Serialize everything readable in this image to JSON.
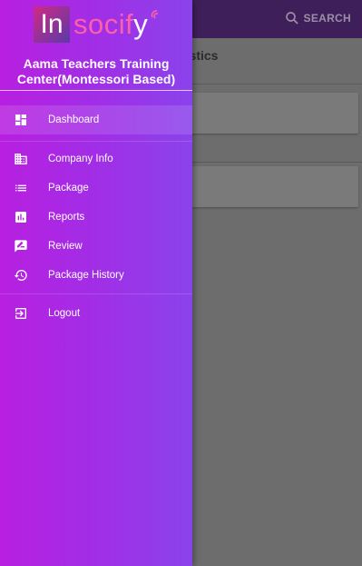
{
  "appbar": {
    "search_label": "SEARCH"
  },
  "background": {
    "section_title": "tistics"
  },
  "drawer": {
    "logo": {
      "part_in": "In",
      "part_soci": "soci",
      "part_f": "f",
      "part_y": "y"
    },
    "org_name_line1": "Aama Teachers Training",
    "org_name_line2": "Center(Montessori Based)",
    "items": [
      {
        "label": "Dashboard",
        "icon": "dashboard-icon",
        "active": true
      },
      {
        "label": "Company Info",
        "icon": "building-icon"
      },
      {
        "label": "Package",
        "icon": "list-icon"
      },
      {
        "label": "Reports",
        "icon": "bar-chart-icon"
      },
      {
        "label": "Review",
        "icon": "rate-review-icon"
      },
      {
        "label": "Package History",
        "icon": "history-icon"
      },
      {
        "label": "Logout",
        "icon": "logout-icon"
      }
    ]
  },
  "colors": {
    "drawer_start": "#b81fe0",
    "drawer_end": "#8a43eb",
    "appbar": "#3f1f5a"
  }
}
